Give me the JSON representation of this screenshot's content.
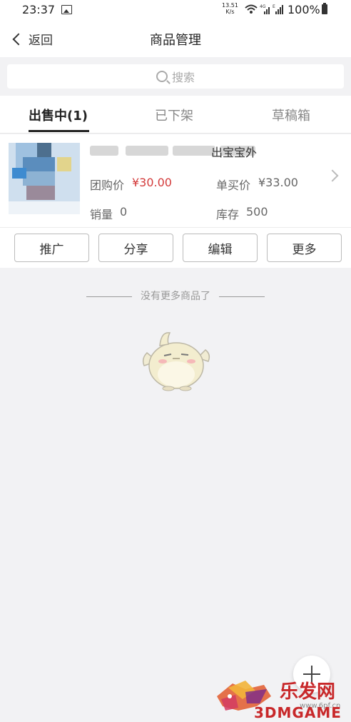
{
  "status_bar": {
    "time": "23:37",
    "net_speed_value": "13.51",
    "net_speed_unit": "K/s",
    "battery": "100%"
  },
  "nav": {
    "back_label": "返回",
    "title": "商品管理"
  },
  "search": {
    "placeholder": "搜索"
  },
  "tabs": [
    {
      "label": "出售中(1)",
      "active": true
    },
    {
      "label": "已下架",
      "active": false
    },
    {
      "label": "草稿箱",
      "active": false
    }
  ],
  "product": {
    "title_visible_tail": "出宝宝外",
    "group_price_label": "团购价",
    "group_price": "¥30.00",
    "single_price_label": "单买价",
    "single_price": "¥33.00",
    "sales_label": "销量",
    "sales": "0",
    "stock_label": "库存",
    "stock": "500"
  },
  "actions": [
    {
      "label": "推广"
    },
    {
      "label": "分享"
    },
    {
      "label": "编辑"
    },
    {
      "label": "更多"
    }
  ],
  "end_message": "没有更多商品了",
  "watermark": {
    "cn_text": "乐发网",
    "url": "www.6pf.cn",
    "game_text": "3DMGAME"
  },
  "colors": {
    "price_red": "#d33a3a",
    "background": "#f2f2f4"
  }
}
